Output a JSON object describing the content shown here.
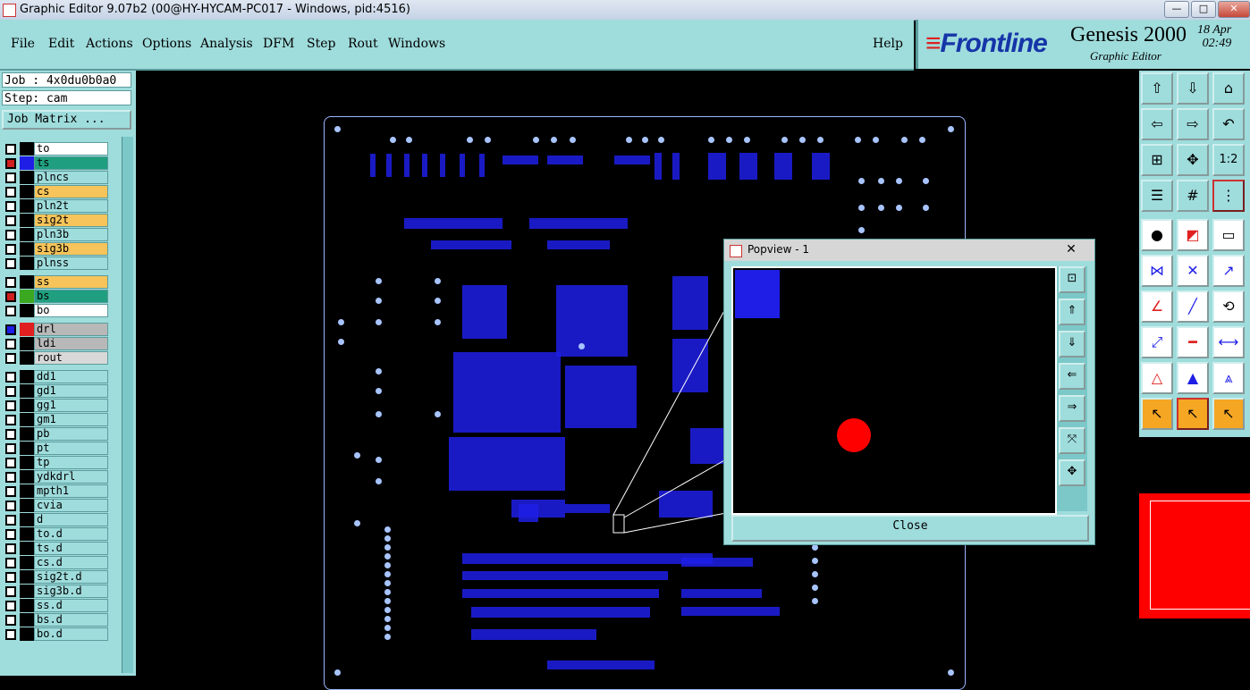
{
  "window": {
    "title": "Graphic Editor 9.07b2 (00@HY-HYCAM-PC017 - Windows, pid:4516)",
    "min": "—",
    "max": "□",
    "close": "✕"
  },
  "menu": {
    "file": "File",
    "edit": "Edit",
    "actions": "Actions",
    "options": "Options",
    "analysis": "Analysis",
    "dfm": "DFM",
    "step": "Step",
    "rout": "Rout",
    "windows": "Windows",
    "help": "Help"
  },
  "brand": {
    "logo_bars": "≡",
    "logo_text": "Frontline",
    "product": "Genesis 2000",
    "subtitle": "Graphic Editor",
    "date": "18 Apr",
    "time": "02:49"
  },
  "job": {
    "job_line": "Job : 4x0du0b0a0",
    "step_line": "Step: cam",
    "matrix_button": "Job Matrix ..."
  },
  "layers": [
    {
      "name": "to",
      "bg": "#ffffff",
      "mark": "",
      "color": "#000000"
    },
    {
      "name": "ts",
      "bg": "#1f9f7f",
      "mark": "#d02020",
      "color": "#1e1ee6"
    },
    {
      "name": "plncs",
      "bg": "#9fdcdc",
      "mark": "",
      "color": "#000000"
    },
    {
      "name": "cs",
      "bg": "#f6c45a",
      "mark": "",
      "color": "#000000"
    },
    {
      "name": "pln2t",
      "bg": "#9fdcdc",
      "mark": "",
      "color": "#000000"
    },
    {
      "name": "sig2t",
      "bg": "#f6c45a",
      "mark": "",
      "color": "#000000"
    },
    {
      "name": "pln3b",
      "bg": "#9fdcdc",
      "mark": "",
      "color": "#000000"
    },
    {
      "name": "sig3b",
      "bg": "#f6c45a",
      "mark": "",
      "color": "#000000"
    },
    {
      "name": "plnss",
      "bg": "#9fdcdc",
      "mark": "",
      "color": "#000000"
    },
    {
      "name": "ss",
      "bg": "#f6c45a",
      "mark": "",
      "color": "#000000"
    },
    {
      "name": "bs",
      "bg": "#1f9f7f",
      "mark": "#d02020",
      "color": "#3aa820"
    },
    {
      "name": "bo",
      "bg": "#ffffff",
      "mark": "",
      "color": "#000000"
    },
    {
      "name": "drl",
      "bg": "#b8b8b8",
      "mark": "#1e1ee6",
      "color": "#e02020"
    },
    {
      "name": "ldi",
      "bg": "#b8b8b8",
      "mark": "",
      "color": "#000000"
    },
    {
      "name": "rout",
      "bg": "#d8d8d8",
      "mark": "",
      "color": "#000000"
    },
    {
      "name": "dd1",
      "bg": "#9fdcdc",
      "mark": "",
      "color": "#000000"
    },
    {
      "name": "gd1",
      "bg": "#9fdcdc",
      "mark": "",
      "color": "#000000"
    },
    {
      "name": "gg1",
      "bg": "#9fdcdc",
      "mark": "",
      "color": "#000000"
    },
    {
      "name": "gm1",
      "bg": "#9fdcdc",
      "mark": "",
      "color": "#000000"
    },
    {
      "name": "pb",
      "bg": "#9fdcdc",
      "mark": "",
      "color": "#000000"
    },
    {
      "name": "pt",
      "bg": "#9fdcdc",
      "mark": "",
      "color": "#000000"
    },
    {
      "name": "tp",
      "bg": "#9fdcdc",
      "mark": "",
      "color": "#000000"
    },
    {
      "name": "ydkdrl",
      "bg": "#9fdcdc",
      "mark": "",
      "color": "#000000"
    },
    {
      "name": "mpth1",
      "bg": "#9fdcdc",
      "mark": "",
      "color": "#000000"
    },
    {
      "name": "cvia",
      "bg": "#9fdcdc",
      "mark": "",
      "color": "#000000"
    },
    {
      "name": "d",
      "bg": "#9fdcdc",
      "mark": "",
      "color": "#000000"
    },
    {
      "name": "to.d",
      "bg": "#9fdcdc",
      "mark": "",
      "color": "#000000"
    },
    {
      "name": "ts.d",
      "bg": "#9fdcdc",
      "mark": "",
      "color": "#000000"
    },
    {
      "name": "cs.d",
      "bg": "#9fdcdc",
      "mark": "",
      "color": "#000000"
    },
    {
      "name": "sig2t.d",
      "bg": "#9fdcdc",
      "mark": "",
      "color": "#000000"
    },
    {
      "name": "sig3b.d",
      "bg": "#9fdcdc",
      "mark": "",
      "color": "#000000"
    },
    {
      "name": "ss.d",
      "bg": "#9fdcdc",
      "mark": "",
      "color": "#000000"
    },
    {
      "name": "bs.d",
      "bg": "#9fdcdc",
      "mark": "",
      "color": "#000000"
    },
    {
      "name": "bo.d",
      "bg": "#9fdcdc",
      "mark": "",
      "color": "#000000"
    }
  ],
  "popview": {
    "title": "Popview - 1",
    "close_x": "✕",
    "close_button": "Close"
  },
  "colors": {
    "panel": "#9fdcdc",
    "pad": "#1e1ee6",
    "drill": "#a8c4ff",
    "highlight": "#ff0000",
    "selected_tool": "#f5a623"
  }
}
